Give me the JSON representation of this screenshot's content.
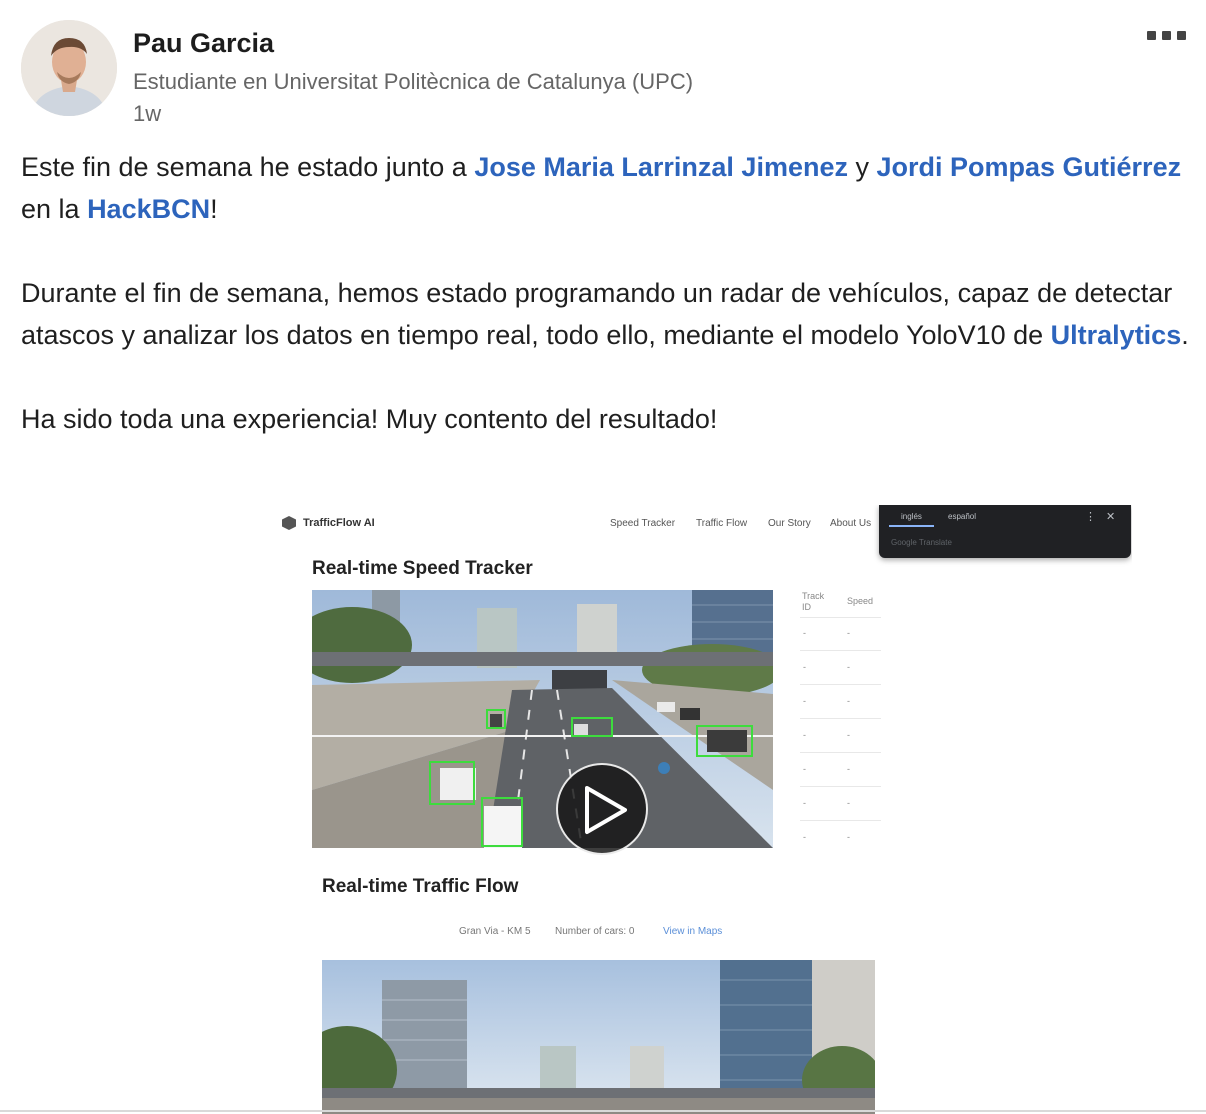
{
  "author": {
    "name": "Pau Garcia",
    "headline": "Estudiante en Universitat Politècnica de Catalunya (UPC)",
    "time": "1w"
  },
  "post": {
    "p1_a": "Este fin de semana he estado junto a ",
    "mention1": "Jose Maria Larrinzal Jimenez",
    "p1_b": " y ",
    "mention2": "Jordi Pompas Gutiérrez",
    "p1_c": " en la ",
    "mention3": "HackBCN",
    "p1_d": "!",
    "p2_a": "Durante el fin de semana, hemos estado programando un radar de vehículos, capaz de detectar atascos y analizar los datos en tiempo real, todo ello, mediante el modelo YoloV10 de ",
    "mention4": "Ultralytics",
    "p2_b": ".",
    "p3": "Ha sido toda una experiencia! Muy contento del resultado!"
  },
  "video": {
    "logo": "TrafficFlow AI",
    "nav": [
      "Speed Tracker",
      "Traffic Flow",
      "Our Story",
      "About Us"
    ],
    "translate": {
      "tab1": "inglés",
      "tab2": "español",
      "kebab": "⋮",
      "close": "✕",
      "placeholder": "Google Translate"
    },
    "speed_title": "Real-time Speed Tracker",
    "table_headers": [
      "Track ID",
      "Speed"
    ],
    "table_rows": [
      [
        "-",
        "-"
      ],
      [
        "-",
        "-"
      ],
      [
        "-",
        "-"
      ],
      [
        "-",
        "-"
      ],
      [
        "-",
        "-"
      ],
      [
        "-",
        "-"
      ],
      [
        "-",
        "-"
      ]
    ],
    "flow_title": "Real-time Traffic Flow",
    "flow_location": "Gran Via - KM 5",
    "flow_cars": "Number of cars: 0",
    "flow_link": "View in Maps"
  },
  "icons": {
    "more": "ellipsis-icon",
    "play": "play-icon"
  },
  "colors": {
    "mention": "#2d64bc",
    "detection_box": "#3ddc3d",
    "translate_bg": "#202124"
  }
}
